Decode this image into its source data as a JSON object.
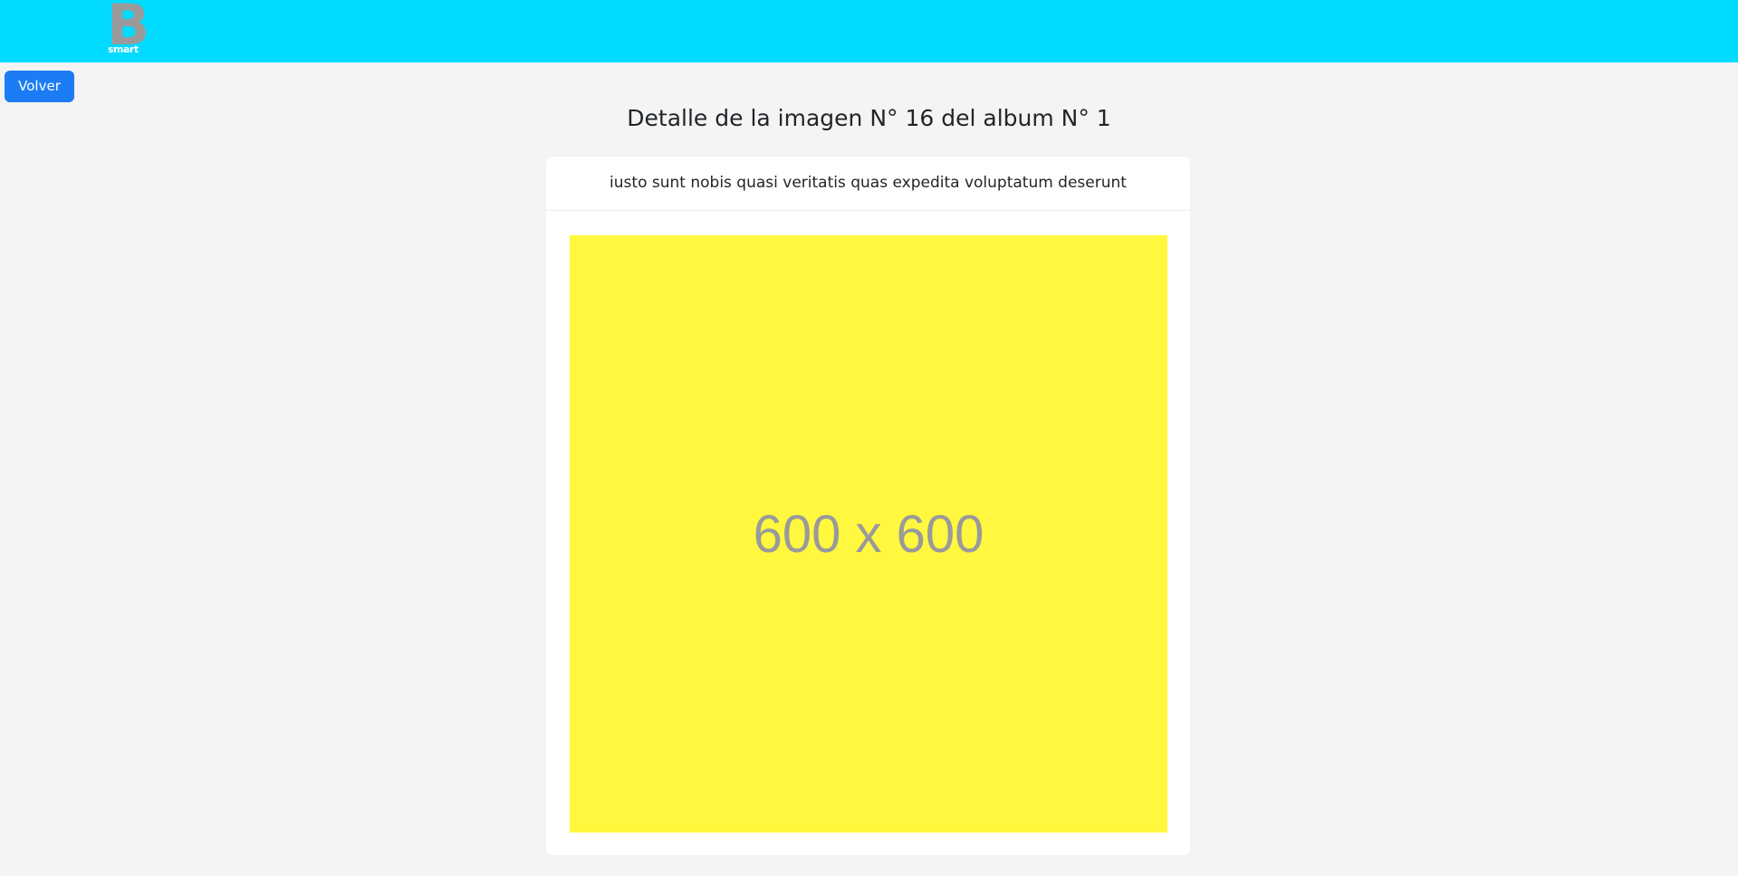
{
  "header": {
    "logo": {
      "letter": "B",
      "text": "smart"
    },
    "colors": {
      "bar": "#00dbff",
      "logo": "#9a9a9a"
    }
  },
  "actions": {
    "back_label": "Volver",
    "back_color": "#1c7cf4"
  },
  "page": {
    "title": "Detalle de la imagen N° 16 del album N° 1"
  },
  "card": {
    "title": "iusto sunt nobis quasi veritatis quas expedita voluptatum deserunt",
    "image": {
      "placeholder_text": "600 x 600",
      "background_color": "#fff83f"
    }
  }
}
